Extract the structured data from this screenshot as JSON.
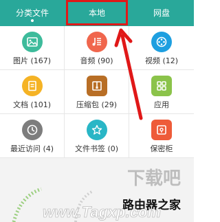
{
  "tabs": [
    {
      "label": "分类文件",
      "active": true
    },
    {
      "label": "本地",
      "active": false
    },
    {
      "label": "网盘",
      "active": false
    }
  ],
  "grid": {
    "items": [
      {
        "label": "图片 (167)",
        "icon": "image-icon",
        "color": "#3dbb9b"
      },
      {
        "label": "音频 (90)",
        "icon": "music-icon",
        "color": "#f0664d"
      },
      {
        "label": "视频 (12)",
        "icon": "video-icon",
        "color": "#1e9fe0"
      },
      {
        "label": "文档 (101)",
        "icon": "document-icon",
        "color": "#f5b325"
      },
      {
        "label": "压缩包 (29)",
        "icon": "archive-icon",
        "color": "#b86e25"
      },
      {
        "label": "应用",
        "icon": "apps-icon",
        "color": "#8bc34a"
      },
      {
        "label": "最近访问 (4)",
        "icon": "clock-icon",
        "color": "#7d7d7d"
      },
      {
        "label": "文件书签 (0)",
        "icon": "star-icon",
        "color": "#29b6c6"
      },
      {
        "label": "保密柜",
        "icon": "safe-icon",
        "color": "#ee5b39"
      }
    ]
  },
  "watermark": {
    "line1": "下载吧",
    "line2": "路由器之家",
    "line3": "www.Tagxp.com"
  },
  "colors": {
    "tabbar": "#29a89a",
    "highlight": "#e01818"
  }
}
